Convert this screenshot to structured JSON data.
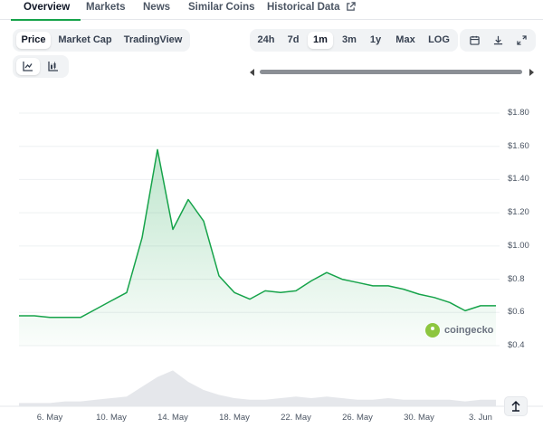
{
  "tabs": [
    {
      "label": "Overview",
      "active": true
    },
    {
      "label": "Markets"
    },
    {
      "label": "News"
    },
    {
      "label": "Similar Coins"
    },
    {
      "label": "Historical Data",
      "icon": "external-link-icon"
    }
  ],
  "chart_type_toggle": [
    "Price",
    "Market Cap",
    "TradingView"
  ],
  "chart_type_selected": "Price",
  "chart_style_toggle": [
    {
      "icon": "line-chart-icon",
      "selected": true
    },
    {
      "icon": "candlestick-chart-icon",
      "selected": false
    }
  ],
  "range_toggle": [
    "24h",
    "7d",
    "1m",
    "3m",
    "1y",
    "Max",
    "LOG"
  ],
  "range_selected": "1m",
  "toolbar_icons": [
    "calendar-icon",
    "download-icon",
    "fullscreen-icon"
  ],
  "watermark": "coingecko",
  "colors": {
    "accent": "#16a34a",
    "line": "#16a34a",
    "volume": "#e5e7eb"
  },
  "chart_data": {
    "type": "area",
    "x": [
      "May 4",
      "May 5",
      "May 6",
      "May 7",
      "May 8",
      "May 9",
      "May 10",
      "May 11",
      "May 12",
      "May 13",
      "May 14",
      "May 15",
      "May 16",
      "May 17",
      "May 18",
      "May 19",
      "May 20",
      "May 21",
      "May 22",
      "May 23",
      "May 24",
      "May 25",
      "May 26",
      "May 27",
      "May 28",
      "May 29",
      "May 30",
      "May 31",
      "Jun 1",
      "Jun 2",
      "Jun 3",
      "Jun 4"
    ],
    "series": [
      {
        "values": [
          0.58,
          0.58,
          0.57,
          0.57,
          0.57,
          0.62,
          0.67,
          0.72,
          1.05,
          1.58,
          1.1,
          1.28,
          1.15,
          0.82,
          0.72,
          0.68,
          0.73,
          0.72,
          0.73,
          0.79,
          0.84,
          0.8,
          0.78,
          0.76,
          0.76,
          0.74,
          0.71,
          0.69,
          0.66,
          0.61,
          0.64,
          0.64
        ]
      },
      {
        "values": [
          0.02,
          0.02,
          0.02,
          0.03,
          0.03,
          0.04,
          0.05,
          0.06,
          0.12,
          0.18,
          0.22,
          0.15,
          0.1,
          0.07,
          0.05,
          0.04,
          0.04,
          0.05,
          0.06,
          0.05,
          0.06,
          0.05,
          0.04,
          0.04,
          0.05,
          0.04,
          0.04,
          0.04,
          0.04,
          0.03,
          0.04,
          0.04
        ]
      }
    ],
    "x_ticks": [
      "6. May",
      "10. May",
      "14. May",
      "18. May",
      "22. May",
      "26. May",
      "30. May",
      "3. Jun"
    ],
    "y_ticks": [
      "$1.80",
      "$1.60",
      "$1.40",
      "$1.20",
      "$1.00",
      "$0.8",
      "$0.6",
      "$0.4"
    ],
    "ylim": [
      0.4,
      1.8
    ],
    "grid": true
  }
}
